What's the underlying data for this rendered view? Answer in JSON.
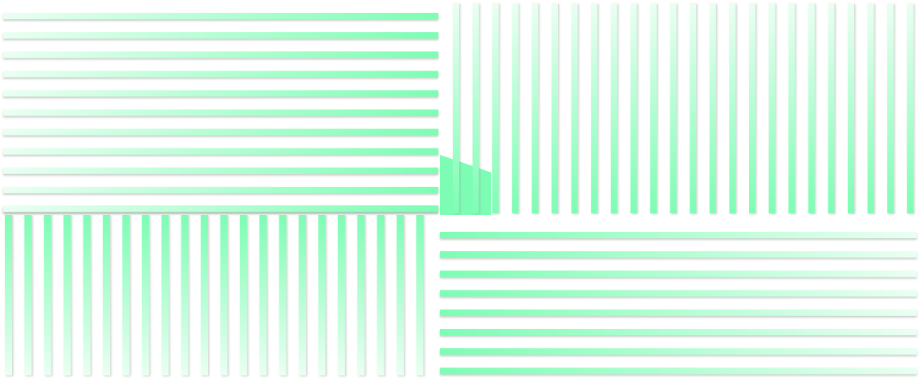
{
  "colors": {
    "background": "#ffffff",
    "stripe_strong": "#7dfdb4",
    "stripe_light": "#eafff2",
    "shadow": "#b9c4bd"
  },
  "quadrants": [
    {
      "name": "top-left",
      "orientation": "horizontal",
      "stripe_count": 11,
      "gradient": "light-to-strong-left-to-right"
    },
    {
      "name": "top-right",
      "orientation": "vertical",
      "stripe_count": 24,
      "gradient": "light-to-strong-top-to-bottom"
    },
    {
      "name": "bottom-left",
      "orientation": "vertical",
      "stripe_count": 22,
      "gradient": "strong-to-light-top-to-bottom"
    },
    {
      "name": "bottom-right",
      "orientation": "horizontal",
      "stripe_count": 8,
      "gradient": "strong-to-light-left-to-right"
    }
  ]
}
